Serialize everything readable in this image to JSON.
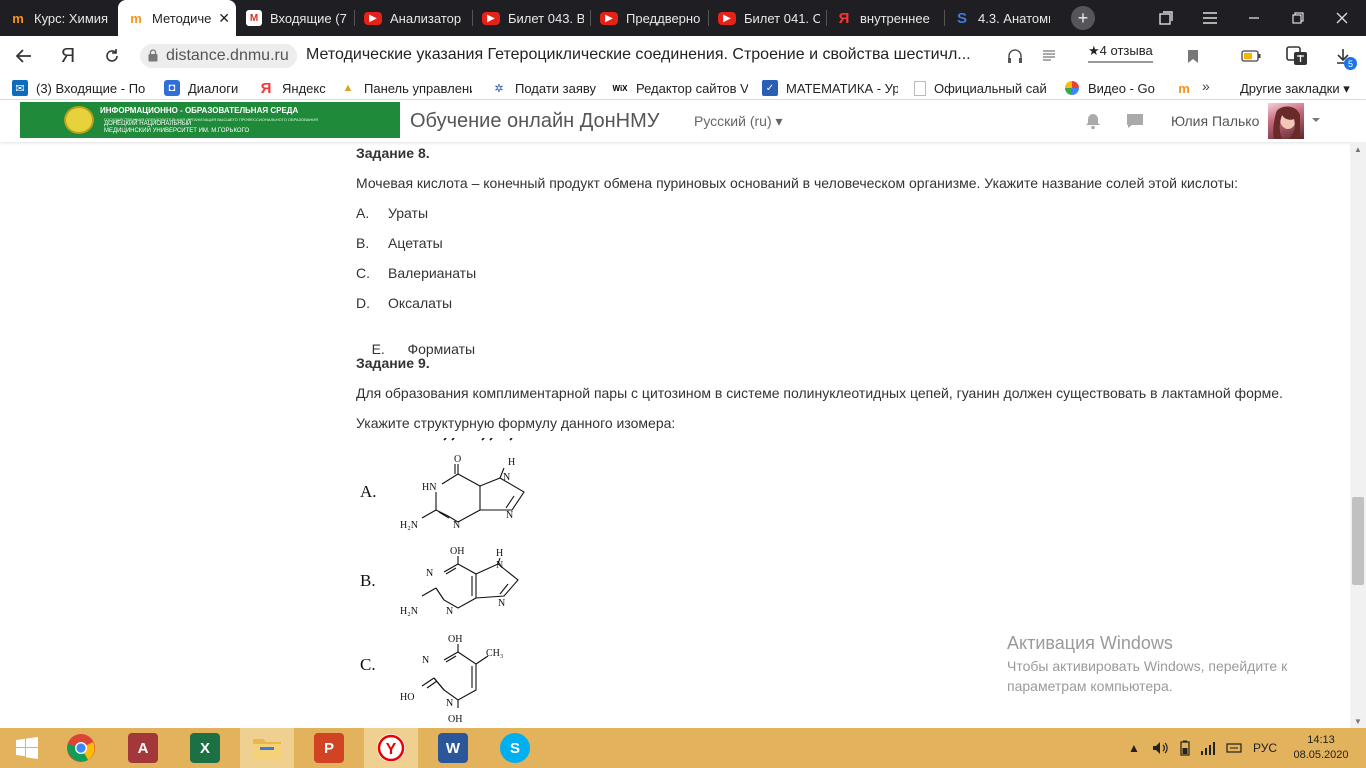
{
  "tabs": [
    {
      "title": "Курс: Химия",
      "icon": "moodle-icon",
      "active": false
    },
    {
      "title": "Методиче",
      "icon": "moodle-icon",
      "active": true
    },
    {
      "title": "Входящие (7",
      "icon": "gmail-icon",
      "active": false
    },
    {
      "title": "Анализатор",
      "icon": "youtube-icon",
      "active": false
    },
    {
      "title": "Билет 043. В",
      "icon": "youtube-icon",
      "active": false
    },
    {
      "title": "Преддверно",
      "icon": "youtube-icon",
      "active": false
    },
    {
      "title": "Билет 041. С",
      "icon": "youtube-icon",
      "active": false
    },
    {
      "title": "внутреннее",
      "icon": "yandex-icon",
      "active": false
    },
    {
      "title": "4.3. Анатоми",
      "icon": "s-icon",
      "active": false
    }
  ],
  "address": {
    "domain": "distance.dnmu.ru",
    "page_title": "Методические указания Гетероциклические соединения. Строение и свойства шестичл...",
    "reviews": "★4 отзыва",
    "download_badge": "5"
  },
  "bookmarks": [
    {
      "label": "(3) Входящие - По",
      "icon": "outlook-icon"
    },
    {
      "label": "Диалоги",
      "icon": "dialogs-icon"
    },
    {
      "label": "Яндекс",
      "icon": "yandex-icon"
    },
    {
      "label": "Панель управлени",
      "icon": "panel-icon"
    },
    {
      "label": "Подати заяву",
      "icon": "emblem-icon"
    },
    {
      "label": "Редактор сайтов V",
      "icon": "wix-icon"
    },
    {
      "label": "МАТЕМАТИКА - Ур",
      "icon": "math-icon"
    },
    {
      "label": "Официальный сай",
      "icon": "doc-icon"
    },
    {
      "label": "Видео - Go",
      "icon": "photos-icon"
    },
    {
      "label": "",
      "icon": "moodle-icon"
    }
  ],
  "bookmarks_more": "»",
  "bookmarks_other": "Другие закладки",
  "header": {
    "logo_line1": "ИНФОРМАЦИОННО - ОБРАЗОВАТЕЛЬНАЯ СРЕДА",
    "logo_line2": "ГОСУДАРСТВЕННАЯ ОБРАЗОВАТЕЛЬНАЯ ОРГАНИЗАЦИЯ ВЫСШЕГО ПРОФЕССИОНАЛЬНОГО ОБРАЗОВАНИЯ",
    "logo_line3": "ДОНЕЦКИЙ НАЦИОНАЛЬНЫЙ",
    "logo_line4": "МЕДИЦИНСКИЙ УНИВЕРСИТЕТ ИМ. М.ГОРЬКОГО",
    "site_name": "Обучение онлайн ДонНМУ",
    "language": "Русский (ru) ▾",
    "user_name": "Юлия Палько"
  },
  "content": {
    "task8_title": "Задание 8.",
    "task8_text": "Мочевая кислота – конечный продукт обмена пуриновых оснований в человеческом организме. Укажите название солей этой кислоты:",
    "task8_options": [
      {
        "letter": "A.",
        "text": "Ураты"
      },
      {
        "letter": "B.",
        "text": "Ацетаты"
      },
      {
        "letter": "C.",
        "text": "Валерианаты"
      },
      {
        "letter": "D.",
        "text": "Оксалаты"
      },
      {
        "letter": "E.",
        "text": " Формиаты"
      }
    ],
    "task9_title": "Задание 9.",
    "task9_text": "Для образования комплиментарной пары с цитозином в системе полинуклеотидных цепей, гуанин должен существовать в лактамной форме.",
    "task9_prompt": "Укажите структурную формулу данного изомера:",
    "formula_labels": [
      "A.",
      "B.",
      "C."
    ],
    "atoms": {
      "o": "O",
      "h": "H",
      "hn": "HN",
      "n": "N",
      "h2n": "H₂N",
      "oh": "OH",
      "ch3": "CH₃",
      "ho": "HO"
    }
  },
  "activation": {
    "title": "Активация Windows",
    "line1": "Чтобы активировать Windows, перейдите к",
    "line2": "параметрам компьютера."
  },
  "taskbar": {
    "apps": [
      "start-icon",
      "chrome-icon",
      "access-icon",
      "excel-icon",
      "explorer-icon",
      "powerpoint-icon",
      "yandex-browser-icon",
      "word-icon",
      "skype-icon"
    ],
    "language": "РУС",
    "time": "14:13",
    "date": "08.05.2020"
  }
}
